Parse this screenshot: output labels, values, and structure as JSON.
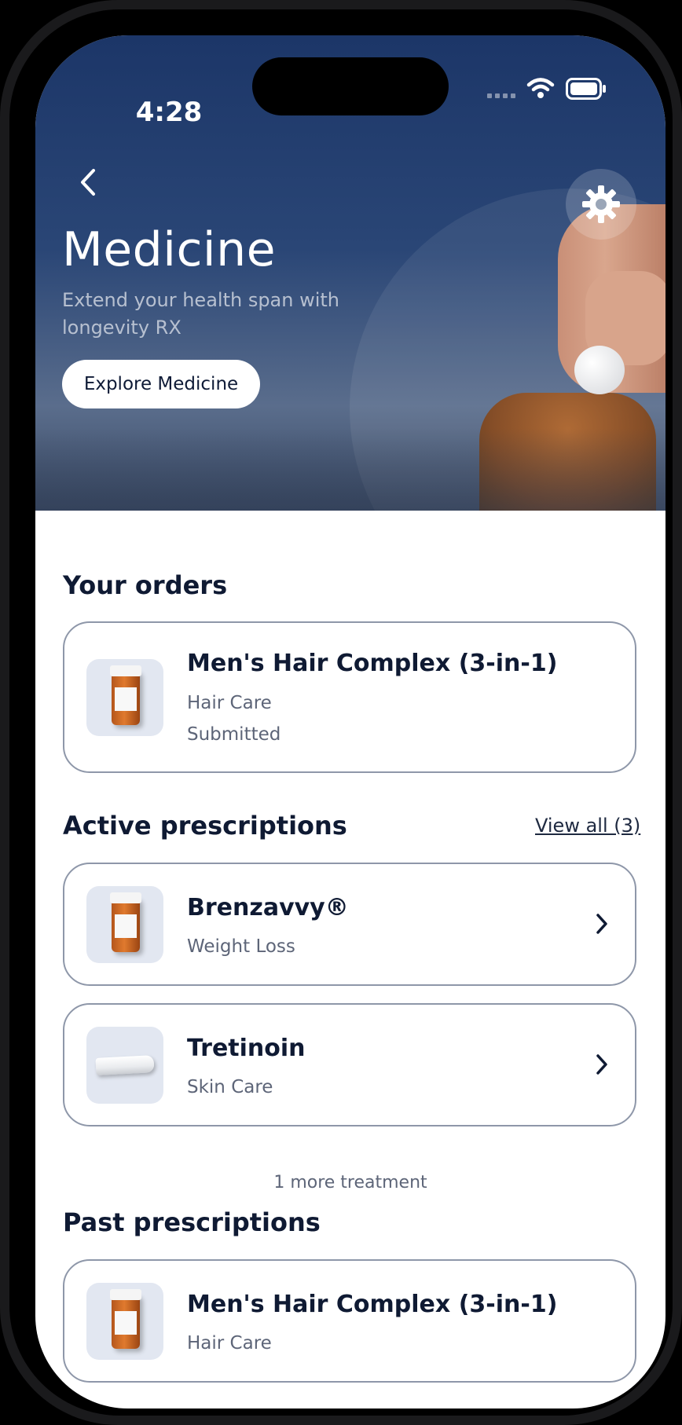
{
  "status_bar": {
    "time": "4:28"
  },
  "hero": {
    "title": "Medicine",
    "subtitle": "Extend your health span with longevity RX",
    "button_label": "Explore Medicine"
  },
  "orders": {
    "heading": "Your orders",
    "items": [
      {
        "name": "Men's Hair Complex (3-in-1)",
        "category": "Hair Care",
        "status": "Submitted",
        "thumb": "rx-bottle-image"
      }
    ]
  },
  "active_prescriptions": {
    "heading": "Active prescriptions",
    "view_all_label": "View all (3)",
    "items": [
      {
        "name": "Brenzavvy®",
        "category": "Weight Loss",
        "thumb": "rx-bottle-image"
      },
      {
        "name": "Tretinoin",
        "category": "Skin Care",
        "thumb": "cream-tube-image"
      }
    ],
    "more_label": "1 more treatment"
  },
  "past_prescriptions": {
    "heading": "Past prescriptions",
    "items": [
      {
        "name": "Men's Hair Complex (3-in-1)",
        "category": "Hair Care",
        "thumb": "rx-bottle-image"
      }
    ]
  },
  "icons": {
    "back": "chevron-left-icon",
    "settings": "gear-icon",
    "row_chevron": "chevron-right-icon",
    "wifi": "wifi-icon",
    "battery": "battery-icon",
    "signal": "cellular-signal-icon"
  },
  "colors": {
    "hero_top": "#1c3668",
    "text_primary": "#0f1a33",
    "text_secondary": "#5d6578",
    "card_border": "#8e97a9",
    "thumb_bg": "#e2e7f1"
  }
}
